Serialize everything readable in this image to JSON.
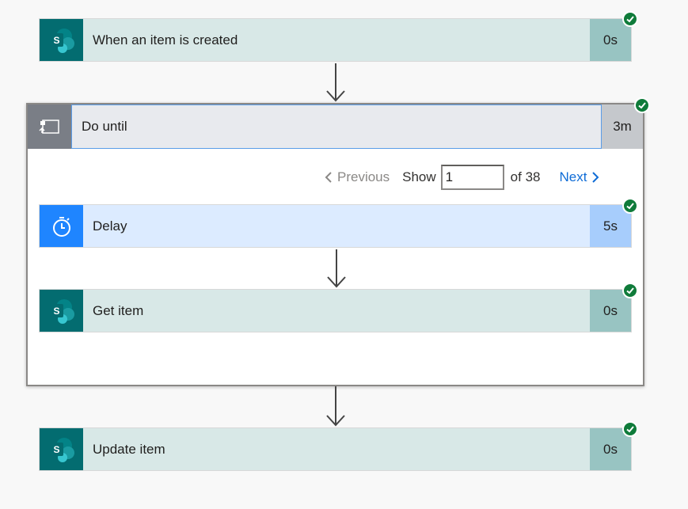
{
  "steps": {
    "trigger": {
      "title": "When an item is created",
      "duration": "0s",
      "icon": "sharepoint-icon",
      "status": "succeeded"
    },
    "loop": {
      "title": "Do until",
      "duration": "3m",
      "icon": "do-until-icon",
      "status": "succeeded"
    },
    "delay": {
      "title": "Delay",
      "duration": "5s",
      "icon": "timer-icon",
      "status": "succeeded"
    },
    "get_item": {
      "title": "Get item",
      "duration": "0s",
      "icon": "sharepoint-icon",
      "status": "succeeded"
    },
    "update_item": {
      "title": "Update item",
      "duration": "0s",
      "icon": "sharepoint-icon",
      "status": "succeeded"
    }
  },
  "pager": {
    "previous_label": "Previous",
    "show_label": "Show",
    "current": "1",
    "of_label": "of 38",
    "next_label": "Next"
  },
  "colors": {
    "sharepoint": "#036c70",
    "delay": "#1f85ff",
    "success": "#0f7b3a",
    "link": "#0f6cd6"
  }
}
